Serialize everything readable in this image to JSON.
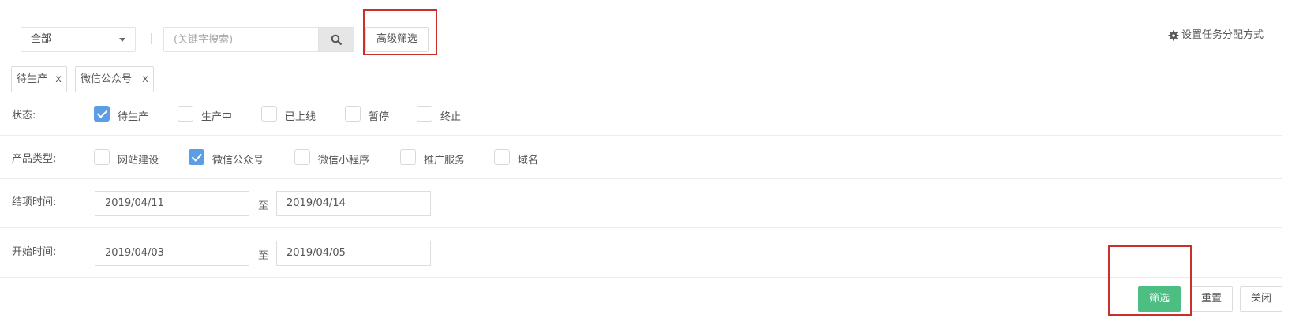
{
  "toolbar": {
    "scope_select": {
      "value": "全部"
    },
    "search": {
      "placeholder": "(关键字搜索)",
      "value": ""
    },
    "advanced_filter_label": "高级筛选",
    "task_assign_label": "设置任务分配方式"
  },
  "active_filters": [
    {
      "label": "待生产",
      "remove": "x"
    },
    {
      "label": "微信公众号",
      "remove": "x"
    }
  ],
  "filters": {
    "status": {
      "label": "状态:",
      "options": [
        {
          "label": "待生产",
          "checked": true
        },
        {
          "label": "生产中",
          "checked": false
        },
        {
          "label": "已上线",
          "checked": false
        },
        {
          "label": "暂停",
          "checked": false
        },
        {
          "label": "终止",
          "checked": false
        }
      ]
    },
    "product_type": {
      "label": "产品类型:",
      "options": [
        {
          "label": "网站建设",
          "checked": false
        },
        {
          "label": "微信公众号",
          "checked": true
        },
        {
          "label": "微信小程序",
          "checked": false
        },
        {
          "label": "推广服务",
          "checked": false
        },
        {
          "label": "域名",
          "checked": false
        }
      ]
    },
    "end_time": {
      "label": "结项时间:",
      "from": "2019/04/11",
      "to_label": "至",
      "to": "2019/04/14"
    },
    "start_time": {
      "label": "开始时间:",
      "from": "2019/04/03",
      "to_label": "至",
      "to": "2019/04/05"
    }
  },
  "actions": {
    "filter_label": "筛选",
    "reset_label": "重置",
    "close_label": "关闭"
  },
  "colors": {
    "checkbox_checked": "#5b9ee6",
    "primary_button": "#4cbe82",
    "highlight_box": "#c9302c"
  }
}
